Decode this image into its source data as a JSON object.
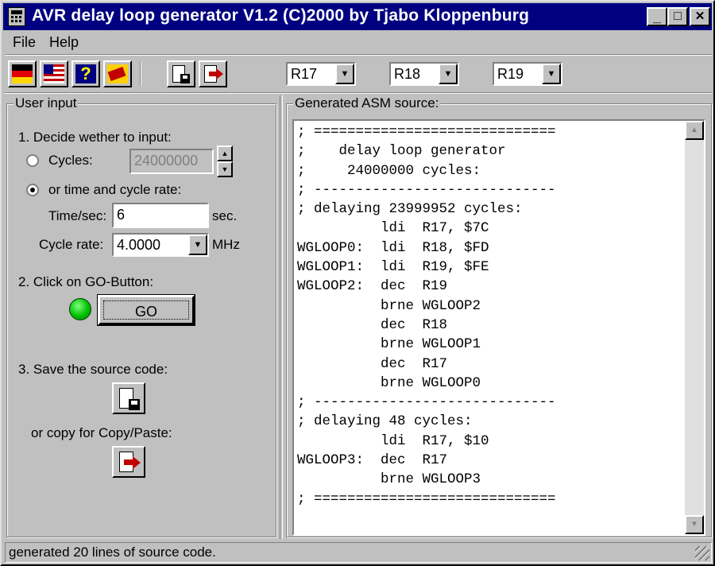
{
  "window": {
    "title": "AVR delay loop generator  V1.2 (C)2000 by Tjabo Kloppenburg",
    "controls": {
      "minimize": "_",
      "maximize": "□",
      "close": "✕"
    }
  },
  "menu": {
    "items": [
      "File",
      "Help"
    ]
  },
  "toolbar": {
    "buttons": [
      "german-flag-icon",
      "usa-flag-icon",
      "help-icon",
      "exit-icon",
      "save-icon",
      "copy-icon"
    ],
    "registers": [
      "R17",
      "R18",
      "R19"
    ]
  },
  "user_input": {
    "group_label": "User input",
    "step1": "1. Decide wether to input:",
    "cycles_label": "Cycles:",
    "cycles_value": "24000000",
    "time_option_label": "or time and cycle rate:",
    "time_label": "Time/sec:",
    "time_value": "6",
    "time_unit": "sec.",
    "cycle_rate_label": "Cycle rate:",
    "cycle_rate_value": "4.0000",
    "cycle_rate_unit": "MHz",
    "step2": "2. Click on GO-Button:",
    "go_label": "GO",
    "step3": "3. Save the source code:",
    "copy_label": "or copy for Copy/Paste:",
    "selected_mode": "time"
  },
  "asm": {
    "group_label": "Generated ASM source:",
    "lines": [
      "; =============================",
      ";    delay loop generator",
      ";     24000000 cycles:",
      "; -----------------------------",
      "; delaying 23999952 cycles:",
      "          ldi  R17, $7C",
      "WGLOOP0:  ldi  R18, $FD",
      "WGLOOP1:  ldi  R19, $FE",
      "WGLOOP2:  dec  R19",
      "          brne WGLOOP2",
      "          dec  R18",
      "          brne WGLOOP1",
      "          dec  R17",
      "          brne WGLOOP0",
      "; -----------------------------",
      "; delaying 48 cycles:",
      "          ldi  R17, $10",
      "WGLOOP3:  dec  R17",
      "          brne WGLOOP3",
      "; ============================="
    ]
  },
  "status": {
    "text": "generated 20 lines of source code."
  }
}
